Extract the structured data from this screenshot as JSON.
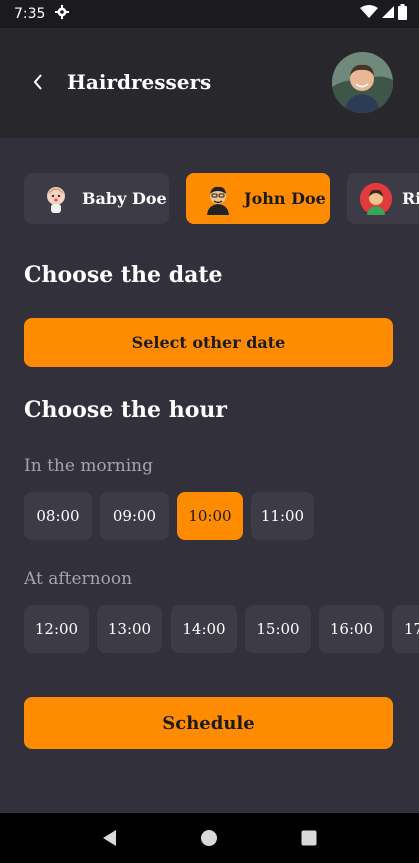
{
  "status_bar": {
    "time": "7:35",
    "icons": [
      "gear-icon",
      "wifi-icon",
      "signal-icon",
      "battery-icon"
    ]
  },
  "app_bar": {
    "title": "Hairdressers",
    "back_icon": "chevron-left-icon",
    "avatar": "user-avatar"
  },
  "hairdressers": [
    {
      "name": "Baby Doe",
      "icon": "baby-avatar-icon",
      "selected": false
    },
    {
      "name": "John Doe",
      "icon": "man-avatar-icon",
      "selected": true
    },
    {
      "name": "Ri",
      "icon": "woman-avatar-icon",
      "selected": false
    }
  ],
  "date_section": {
    "title": "Choose the date",
    "button_label": "Select other date"
  },
  "hour_section": {
    "title": "Choose the hour",
    "morning_label": "In the morning",
    "morning_hours": [
      "08:00",
      "09:00",
      "10:00",
      "11:00"
    ],
    "morning_selected": "10:00",
    "afternoon_label": "At afternoon",
    "afternoon_hours": [
      "12:00",
      "13:00",
      "14:00",
      "15:00",
      "16:00",
      "17"
    ]
  },
  "schedule_button": {
    "label": "Schedule"
  },
  "colors": {
    "accent": "#ff8c00",
    "background": "#32303a",
    "app_bar": "#28272c",
    "chip": "#3d3b45"
  },
  "nav_bar": {
    "icons": [
      "back-triangle-icon",
      "home-circle-icon",
      "recents-square-icon"
    ]
  }
}
